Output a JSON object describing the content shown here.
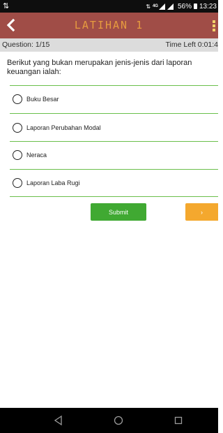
{
  "status_bar": {
    "network": "4G",
    "battery": "56%",
    "time": "13:23",
    "icons": [
      "sync-icon",
      "data-arrows-icon",
      "signal-icon",
      "signal-icon",
      "battery-icon"
    ]
  },
  "app_bar": {
    "title": "LATIHAN 1",
    "back_icon": "chevron-left-icon",
    "menu_icon": "overflow-menu-icon"
  },
  "info_bar": {
    "question_counter": "Question: 1/15",
    "time_left": "Time Left 0:01:4"
  },
  "question": {
    "text": "Berikut yang bukan merupakan jenis-jenis dari laporan keuangan ialah:",
    "options": [
      {
        "label": "Buku Besar",
        "selected": false
      },
      {
        "label": "Laporan Perubahan Modal",
        "selected": false
      },
      {
        "label": "Neraca",
        "selected": false
      },
      {
        "label": "Laporan Laba Rugi",
        "selected": false
      }
    ]
  },
  "actions": {
    "submit_label": "Submit",
    "next_label": "›"
  },
  "nav_bar": {
    "icons": [
      "back-triangle-icon",
      "home-circle-icon",
      "recents-square-icon"
    ]
  },
  "colors": {
    "app_bar": "#a04d47",
    "title": "#e69b3f",
    "divider": "#6abf4b",
    "submit": "#40a932",
    "next": "#f4a82e",
    "info_bar": "#dcdcdc"
  }
}
